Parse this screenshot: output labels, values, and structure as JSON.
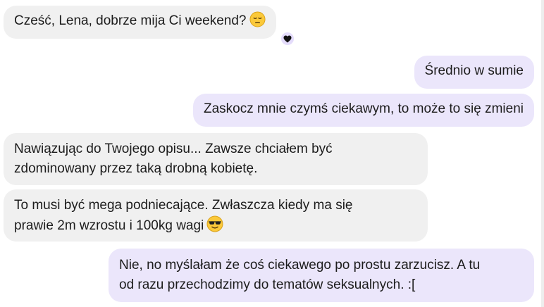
{
  "messages": [
    {
      "side": "incoming",
      "text": "Cześć, Lena, dobrze mija Ci weekend?",
      "emoji": "pensive-face-emoji",
      "reaction": "heart-reaction"
    },
    {
      "side": "outgoing",
      "text": "Średnio w sumie"
    },
    {
      "side": "outgoing",
      "text": "Zaskocz mnie czymś ciekawym, to może to się zmieni"
    },
    {
      "side": "incoming",
      "lines": [
        "Nawiązując do Twojego opisu... Zawsze chciałem być",
        "zdominowany przez taką drobną kobietę."
      ]
    },
    {
      "side": "incoming",
      "lines": [
        "To musi być mega podniecające. Zwłaszcza kiedy ma się",
        "prawie 2m wzrostu i 100kg wagi"
      ],
      "emoji": "sunglasses-face-emoji"
    },
    {
      "side": "outgoing",
      "lines": [
        "Nie, no myślałam że coś ciekawego po prostu zarzucisz. A tu",
        "od razu przechodzimy do tematów seksualnych. :["
      ]
    }
  ],
  "colors": {
    "incoming_bubble": "#f0f0f0",
    "outgoing_bubble": "#ebe6fb",
    "text": "#1c1c1c",
    "reaction_background": "#e4dcfb",
    "emoji_yellow": "#fbc93a"
  }
}
